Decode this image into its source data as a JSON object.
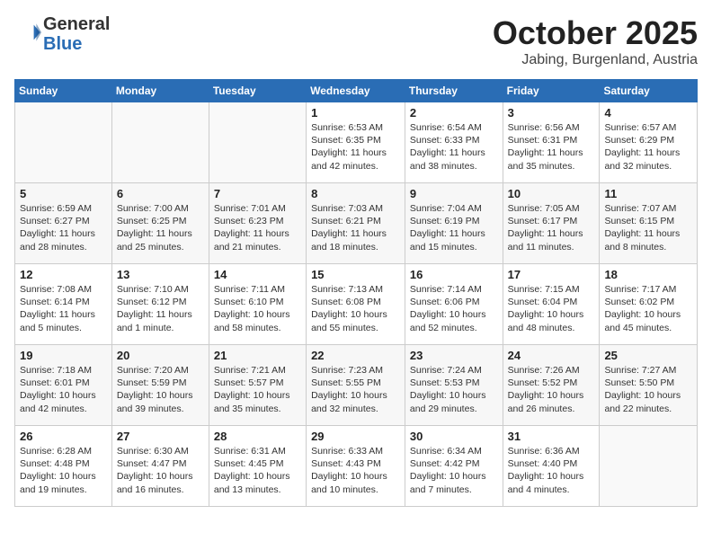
{
  "header": {
    "logo_general": "General",
    "logo_blue": "Blue",
    "month": "October 2025",
    "location": "Jabing, Burgenland, Austria"
  },
  "weekdays": [
    "Sunday",
    "Monday",
    "Tuesday",
    "Wednesday",
    "Thursday",
    "Friday",
    "Saturday"
  ],
  "weeks": [
    [
      {
        "day": "",
        "info": ""
      },
      {
        "day": "",
        "info": ""
      },
      {
        "day": "",
        "info": ""
      },
      {
        "day": "1",
        "info": "Sunrise: 6:53 AM\nSunset: 6:35 PM\nDaylight: 11 hours and 42 minutes."
      },
      {
        "day": "2",
        "info": "Sunrise: 6:54 AM\nSunset: 6:33 PM\nDaylight: 11 hours and 38 minutes."
      },
      {
        "day": "3",
        "info": "Sunrise: 6:56 AM\nSunset: 6:31 PM\nDaylight: 11 hours and 35 minutes."
      },
      {
        "day": "4",
        "info": "Sunrise: 6:57 AM\nSunset: 6:29 PM\nDaylight: 11 hours and 32 minutes."
      }
    ],
    [
      {
        "day": "5",
        "info": "Sunrise: 6:59 AM\nSunset: 6:27 PM\nDaylight: 11 hours and 28 minutes."
      },
      {
        "day": "6",
        "info": "Sunrise: 7:00 AM\nSunset: 6:25 PM\nDaylight: 11 hours and 25 minutes."
      },
      {
        "day": "7",
        "info": "Sunrise: 7:01 AM\nSunset: 6:23 PM\nDaylight: 11 hours and 21 minutes."
      },
      {
        "day": "8",
        "info": "Sunrise: 7:03 AM\nSunset: 6:21 PM\nDaylight: 11 hours and 18 minutes."
      },
      {
        "day": "9",
        "info": "Sunrise: 7:04 AM\nSunset: 6:19 PM\nDaylight: 11 hours and 15 minutes."
      },
      {
        "day": "10",
        "info": "Sunrise: 7:05 AM\nSunset: 6:17 PM\nDaylight: 11 hours and 11 minutes."
      },
      {
        "day": "11",
        "info": "Sunrise: 7:07 AM\nSunset: 6:15 PM\nDaylight: 11 hours and 8 minutes."
      }
    ],
    [
      {
        "day": "12",
        "info": "Sunrise: 7:08 AM\nSunset: 6:14 PM\nDaylight: 11 hours and 5 minutes."
      },
      {
        "day": "13",
        "info": "Sunrise: 7:10 AM\nSunset: 6:12 PM\nDaylight: 11 hours and 1 minute."
      },
      {
        "day": "14",
        "info": "Sunrise: 7:11 AM\nSunset: 6:10 PM\nDaylight: 10 hours and 58 minutes."
      },
      {
        "day": "15",
        "info": "Sunrise: 7:13 AM\nSunset: 6:08 PM\nDaylight: 10 hours and 55 minutes."
      },
      {
        "day": "16",
        "info": "Sunrise: 7:14 AM\nSunset: 6:06 PM\nDaylight: 10 hours and 52 minutes."
      },
      {
        "day": "17",
        "info": "Sunrise: 7:15 AM\nSunset: 6:04 PM\nDaylight: 10 hours and 48 minutes."
      },
      {
        "day": "18",
        "info": "Sunrise: 7:17 AM\nSunset: 6:02 PM\nDaylight: 10 hours and 45 minutes."
      }
    ],
    [
      {
        "day": "19",
        "info": "Sunrise: 7:18 AM\nSunset: 6:01 PM\nDaylight: 10 hours and 42 minutes."
      },
      {
        "day": "20",
        "info": "Sunrise: 7:20 AM\nSunset: 5:59 PM\nDaylight: 10 hours and 39 minutes."
      },
      {
        "day": "21",
        "info": "Sunrise: 7:21 AM\nSunset: 5:57 PM\nDaylight: 10 hours and 35 minutes."
      },
      {
        "day": "22",
        "info": "Sunrise: 7:23 AM\nSunset: 5:55 PM\nDaylight: 10 hours and 32 minutes."
      },
      {
        "day": "23",
        "info": "Sunrise: 7:24 AM\nSunset: 5:53 PM\nDaylight: 10 hours and 29 minutes."
      },
      {
        "day": "24",
        "info": "Sunrise: 7:26 AM\nSunset: 5:52 PM\nDaylight: 10 hours and 26 minutes."
      },
      {
        "day": "25",
        "info": "Sunrise: 7:27 AM\nSunset: 5:50 PM\nDaylight: 10 hours and 22 minutes."
      }
    ],
    [
      {
        "day": "26",
        "info": "Sunrise: 6:28 AM\nSunset: 4:48 PM\nDaylight: 10 hours and 19 minutes."
      },
      {
        "day": "27",
        "info": "Sunrise: 6:30 AM\nSunset: 4:47 PM\nDaylight: 10 hours and 16 minutes."
      },
      {
        "day": "28",
        "info": "Sunrise: 6:31 AM\nSunset: 4:45 PM\nDaylight: 10 hours and 13 minutes."
      },
      {
        "day": "29",
        "info": "Sunrise: 6:33 AM\nSunset: 4:43 PM\nDaylight: 10 hours and 10 minutes."
      },
      {
        "day": "30",
        "info": "Sunrise: 6:34 AM\nSunset: 4:42 PM\nDaylight: 10 hours and 7 minutes."
      },
      {
        "day": "31",
        "info": "Sunrise: 6:36 AM\nSunset: 4:40 PM\nDaylight: 10 hours and 4 minutes."
      },
      {
        "day": "",
        "info": ""
      }
    ]
  ]
}
